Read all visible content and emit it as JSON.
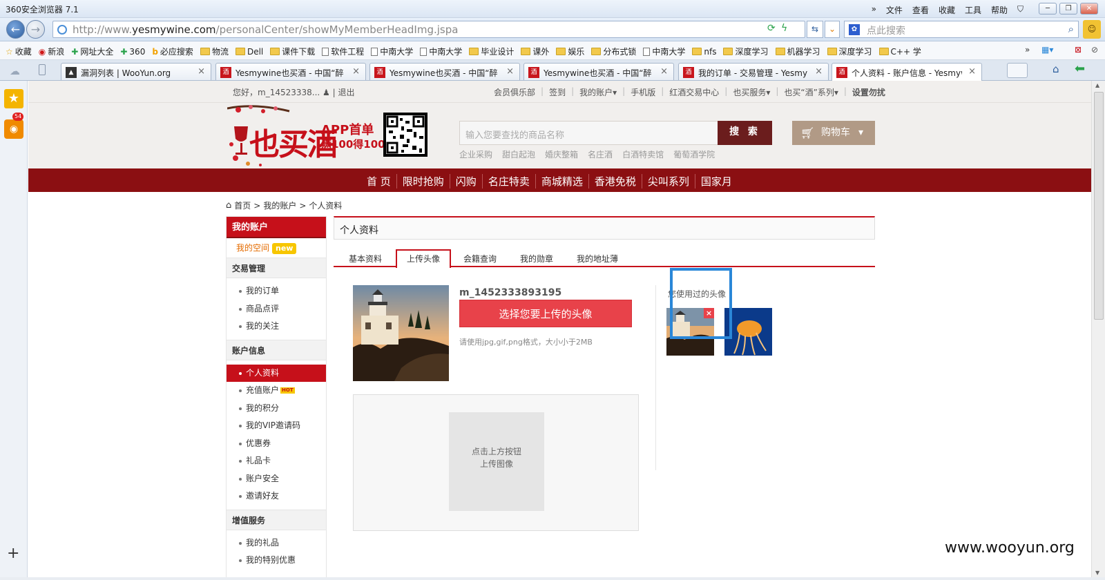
{
  "window": {
    "title": "360安全浏览器 7.1",
    "menus": [
      "文件",
      "查看",
      "收藏",
      "工具",
      "帮助"
    ],
    "chevrons": "»"
  },
  "nav": {
    "url_prefix": "http://www.",
    "url_host": "yesmywine.com",
    "url_path": "/personalCenter/showMyMemberHeadImg.jspa",
    "search_placeholder": "点此搜索"
  },
  "favorites": [
    {
      "label": "收藏",
      "icon": "star-icon"
    },
    {
      "label": "新浪",
      "icon": "sina-icon"
    },
    {
      "label": "网址大全",
      "icon": "plus-icon"
    },
    {
      "label": "360",
      "icon": "plus-icon"
    },
    {
      "label": "必应搜索",
      "icon": "bing-icon"
    },
    {
      "label": "物流",
      "icon": "folder-icon"
    },
    {
      "label": "Dell",
      "icon": "folder-icon"
    },
    {
      "label": "课件下载",
      "icon": "folder-icon"
    },
    {
      "label": "软件工程",
      "icon": "page-icon"
    },
    {
      "label": "中南大学",
      "icon": "page-icon"
    },
    {
      "label": "中南大学",
      "icon": "page-icon"
    },
    {
      "label": "毕业设计",
      "icon": "folder-icon"
    },
    {
      "label": "课外",
      "icon": "folder-icon"
    },
    {
      "label": "娱乐",
      "icon": "folder-icon"
    },
    {
      "label": "分布式锁",
      "icon": "folder-icon"
    },
    {
      "label": "中南大学",
      "icon": "page-icon"
    },
    {
      "label": "nfs",
      "icon": "folder-icon"
    },
    {
      "label": "深度学习",
      "icon": "folder-icon"
    },
    {
      "label": "机器学习",
      "icon": "folder-icon"
    },
    {
      "label": "深度学习",
      "icon": "folder-icon"
    },
    {
      "label": "C++ 学",
      "icon": "folder-icon"
    }
  ],
  "tabs": [
    {
      "label": "漏洞列表 | WooYun.org",
      "icon": "wooyun-icon",
      "active": false
    },
    {
      "label": "Yesmywine也买酒 - 中国“醉",
      "icon": "yesmywine-icon",
      "active": false
    },
    {
      "label": "Yesmywine也买酒 - 中国“醉",
      "icon": "yesmywine-icon",
      "active": false
    },
    {
      "label": "Yesmywine也买酒 - 中国“醉",
      "icon": "yesmywine-icon",
      "active": false
    },
    {
      "label": "我的订单 - 交易管理 - Yesmy",
      "icon": "yesmywine-icon",
      "active": false
    },
    {
      "label": "个人资料 - 账户信息 - Yesmyw",
      "icon": "yesmywine-icon",
      "active": true
    }
  ],
  "tab_close": "×",
  "sidebar": {
    "badge": "54",
    "add": "+"
  },
  "site": {
    "greeting": "您好，m_14523338...",
    "logout": "退出",
    "toplinks": [
      "会员俱乐部",
      "签到",
      "我的账户▾",
      "手机版",
      "红酒交易中心",
      "也买服务▾",
      "也买“酒”系列▾",
      "设置勿扰"
    ],
    "logo": "也买酒",
    "promo1": "APP首单",
    "promo2": "满100得100",
    "search_placeholder": "输入您要查找的商品名称",
    "search_button": "搜 索",
    "cart": "购物车",
    "hotlinks": [
      "企业采购",
      "甜白起泡",
      "婚庆整箱",
      "名庄酒",
      "白酒特卖馆",
      "葡萄酒学院"
    ],
    "mainnav": [
      "首 页",
      "限时抢购",
      "闪购",
      "名庄特卖",
      "商城精选",
      "香港免税",
      "尖叫系列",
      "国家月"
    ],
    "breadcrumb": [
      "首页",
      ">",
      "我的账户",
      ">",
      "个人资料"
    ]
  },
  "leftmenu": {
    "head": "我的账户",
    "space": "我的空间",
    "new_badge": "new",
    "sections": [
      {
        "title": "交易管理",
        "items": [
          "我的订单",
          "商品点评",
          "我的关注"
        ]
      },
      {
        "title": "账户信息",
        "items": [
          "个人资料",
          "充值账户",
          "我的积分",
          "我的VIP邀请码",
          "优惠券",
          "礼品卡",
          "账户安全",
          "邀请好友"
        ]
      },
      {
        "title": "增值服务",
        "items": [
          "我的礼品",
          "我的特别优惠"
        ]
      }
    ],
    "hot_badge": "HOT"
  },
  "content": {
    "panel_title": "个人资料",
    "tabs": [
      "基本资料",
      "上传头像",
      "会籍查询",
      "我的勋章",
      "我的地址薄"
    ],
    "active_tab": "上传头像",
    "username": "m_1452333893195",
    "upload_button": "选择您要上传的头像",
    "upload_hint": "请使用jpg,gif,png格式，大小小于2MB",
    "preview_line1": "点击上方按钮",
    "preview_line2": "上传图像",
    "used_label": "您使用过的头像",
    "delete": "×"
  },
  "watermark": "www.wooyun.org"
}
